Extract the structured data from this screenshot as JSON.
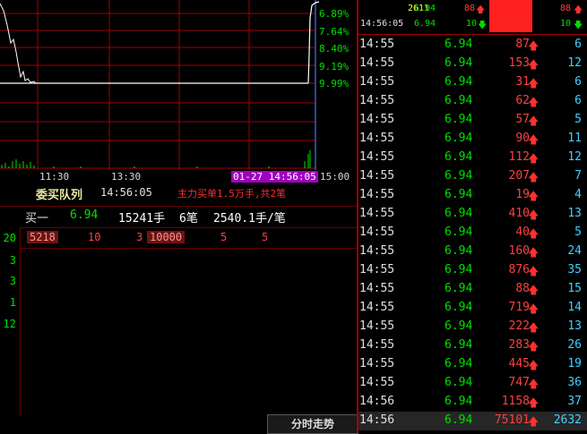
{
  "chart": {
    "pct_labels": [
      "6.89%",
      "7.64%",
      "8.40%",
      "9.19%",
      "9.99%"
    ],
    "time_labels": [
      "11:30",
      "13:30",
      "15:00"
    ],
    "cursor_label": "01-27 14:56:05",
    "colors": {
      "grid": "#a00000",
      "price_line": "#ffffff",
      "avg_line": "#ffffff",
      "up": "#00e000",
      "cursor": "#3a78ff"
    }
  },
  "queue": {
    "title": "委买队列",
    "time": "14:56:05",
    "note": "主力买单1.5万手,共2笔",
    "buy1": {
      "label": "买一",
      "price": "6.94",
      "volume": "15241手",
      "count": "6笔",
      "avg": "2540.1手/笔"
    },
    "orders": [
      "5218",
      "10",
      "3",
      "10000",
      "5",
      "5"
    ],
    "left_numbers": [
      "20",
      "3",
      "3",
      "1",
      "12"
    ]
  },
  "ticks_header": {
    "row1": {
      "time": "",
      "id": "2611",
      "price": "6.94",
      "vol": "88",
      "cnt": "88"
    },
    "row2": {
      "time": "14:56:05",
      "price": "6.94",
      "vol": "10",
      "cnt": "10"
    }
  },
  "ticks": [
    {
      "time": "14:55",
      "price": "6.94",
      "vol": "87",
      "cnt": "6"
    },
    {
      "time": "14:55",
      "price": "6.94",
      "vol": "153",
      "cnt": "12"
    },
    {
      "time": "14:55",
      "price": "6.94",
      "vol": "31",
      "cnt": "6"
    },
    {
      "time": "14:55",
      "price": "6.94",
      "vol": "62",
      "cnt": "6"
    },
    {
      "time": "14:55",
      "price": "6.94",
      "vol": "57",
      "cnt": "5"
    },
    {
      "time": "14:55",
      "price": "6.94",
      "vol": "90",
      "cnt": "11"
    },
    {
      "time": "14:55",
      "price": "6.94",
      "vol": "112",
      "cnt": "12"
    },
    {
      "time": "14:55",
      "price": "6.94",
      "vol": "207",
      "cnt": "7"
    },
    {
      "time": "14:55",
      "price": "6.94",
      "vol": "19",
      "cnt": "4"
    },
    {
      "time": "14:55",
      "price": "6.94",
      "vol": "410",
      "cnt": "13"
    },
    {
      "time": "14:55",
      "price": "6.94",
      "vol": "40",
      "cnt": "5"
    },
    {
      "time": "14:55",
      "price": "6.94",
      "vol": "160",
      "cnt": "24"
    },
    {
      "time": "14:55",
      "price": "6.94",
      "vol": "876",
      "cnt": "35"
    },
    {
      "time": "14:55",
      "price": "6.94",
      "vol": "88",
      "cnt": "15"
    },
    {
      "time": "14:55",
      "price": "6.94",
      "vol": "719",
      "cnt": "14"
    },
    {
      "time": "14:55",
      "price": "6.94",
      "vol": "222",
      "cnt": "13"
    },
    {
      "time": "14:55",
      "price": "6.94",
      "vol": "283",
      "cnt": "26"
    },
    {
      "time": "14:55",
      "price": "6.94",
      "vol": "445",
      "cnt": "19"
    },
    {
      "time": "14:55",
      "price": "6.94",
      "vol": "747",
      "cnt": "36"
    },
    {
      "time": "14:56",
      "price": "6.94",
      "vol": "1158",
      "cnt": "37"
    },
    {
      "time": "14:56",
      "price": "6.94",
      "vol": "75101",
      "cnt": "2632"
    }
  ],
  "footer": {
    "tab_label": "分时走势"
  }
}
